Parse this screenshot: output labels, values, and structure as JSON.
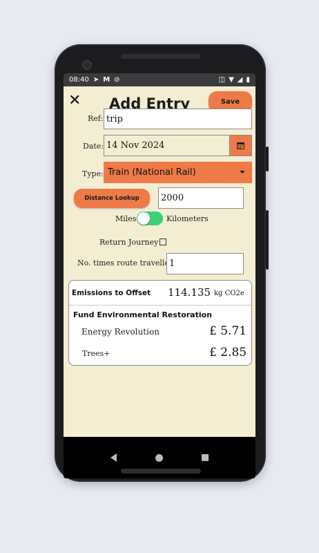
{
  "status_bar": {
    "time": "08:40",
    "left_icons": [
      "navigation-icon",
      "gmail-icon",
      "do-not-disturb-icon"
    ],
    "right_icons": [
      "vibrate-icon",
      "wifi-icon",
      "cellular-icon",
      "battery-icon"
    ]
  },
  "header": {
    "close_icon": "close-icon",
    "title": "Add Entry",
    "save_label": "Save"
  },
  "form": {
    "ref_label": "Ref:",
    "ref_value": "trip",
    "date_label": "Date:",
    "date_value": "14 Nov 2024",
    "type_label": "Type:",
    "type_value": "Train (National Rail)",
    "distance_lookup_label": "Distance Lookup",
    "distance_value": "2000",
    "units_left": "Miles",
    "units_right": "Kilometers",
    "units_toggle_kilometers": true,
    "return_journey_label": "Return Journey",
    "return_journey_checked": false,
    "times_label": "No. times route travelled:",
    "times_value": "1"
  },
  "emissions": {
    "label": "Emissions to Offset",
    "value": "114.135",
    "unit": "kg CO2e"
  },
  "fund": {
    "heading": "Fund Environmental Restoration",
    "items": [
      {
        "name": "Energy Revolution",
        "amount": "£ 5.71"
      },
      {
        "name": "Trees+",
        "amount": "£ 2.85"
      }
    ]
  },
  "colors": {
    "accent": "#ee7a47",
    "background": "#f3edd2",
    "toggle": "#3ed07a"
  }
}
